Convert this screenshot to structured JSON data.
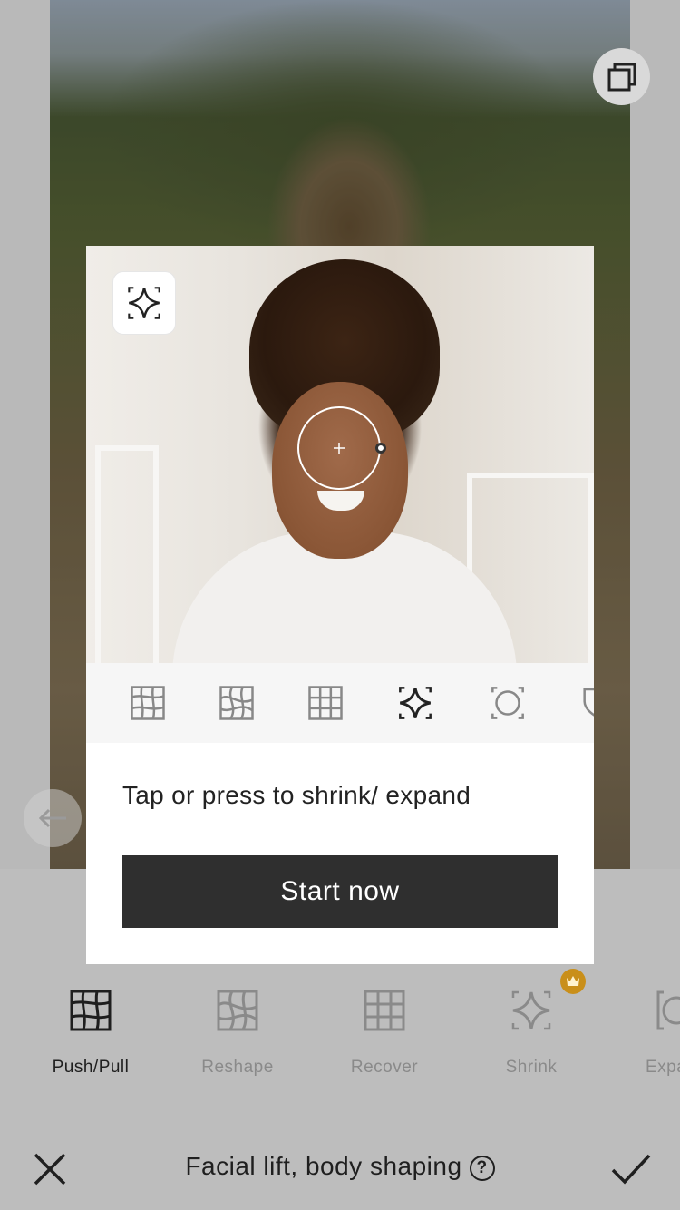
{
  "modal": {
    "description": "Tap or press to shrink/ expand",
    "start_button_label": "Start now"
  },
  "tools": [
    {
      "label": "Push/Pull",
      "icon": "push-pull-icon",
      "active": true
    },
    {
      "label": "Reshape",
      "icon": "reshape-icon",
      "active": false
    },
    {
      "label": "Recover",
      "icon": "recover-icon",
      "active": false
    },
    {
      "label": "Shrink",
      "icon": "shrink-icon",
      "active": false,
      "premium": true
    },
    {
      "label": "Expa",
      "icon": "expand-icon",
      "active": false
    }
  ],
  "bottom_bar": {
    "title": "Facial lift, body shaping",
    "help_symbol": "?"
  },
  "colors": {
    "premium_badge": "#c98f1a",
    "button_dark": "#2f2f2f",
    "panel_bg": "#bdbdbd"
  }
}
